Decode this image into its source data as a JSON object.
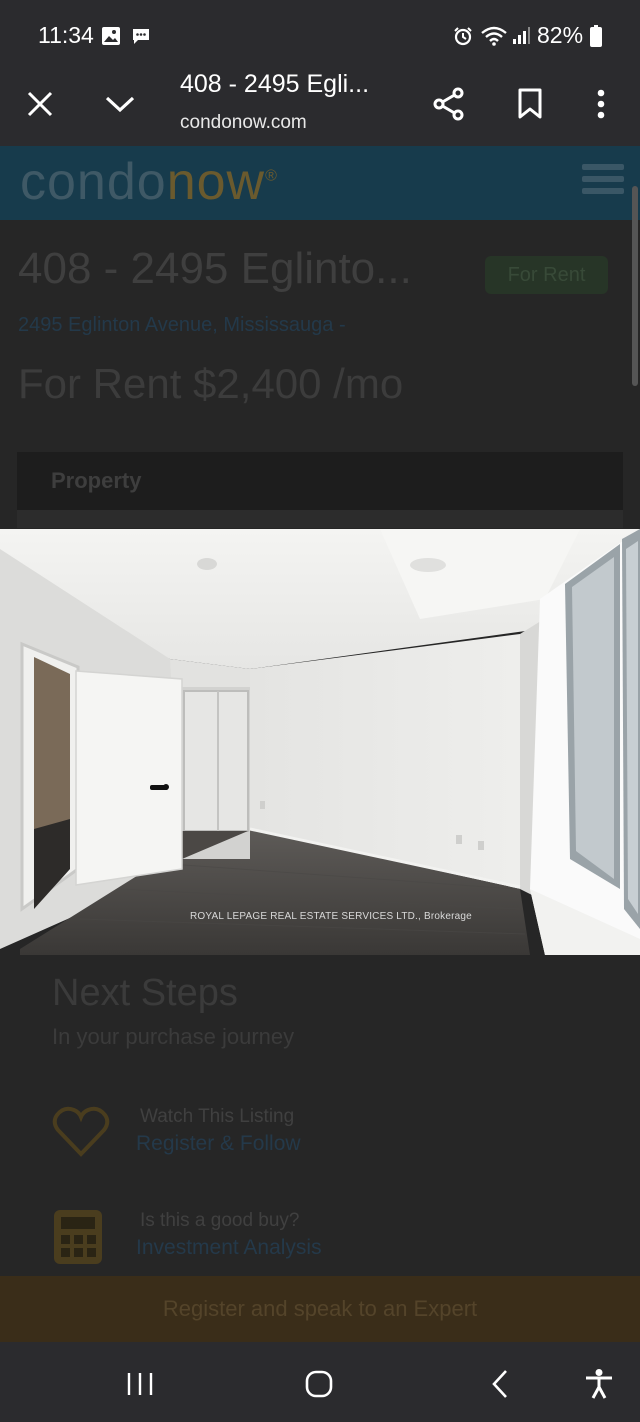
{
  "status_bar": {
    "time": "11:34",
    "battery": "82%",
    "icons": [
      "gallery-icon",
      "message-icon",
      "alarm-icon",
      "wifi-icon",
      "signal-icon",
      "battery-icon"
    ]
  },
  "browser": {
    "title": "408 - 2495 Egli...",
    "url": "condonow.com",
    "buttons": [
      "close-icon",
      "chevron-down-icon",
      "share-icon",
      "bookmark-icon",
      "more-vert-icon"
    ]
  },
  "site": {
    "logo_part1": "condo",
    "logo_part2": "now",
    "logo_mark": "®",
    "listing_title": "408 - 2495 Eglinto...",
    "status_badge": "For Rent",
    "address": "2495 Eglinton Avenue, Mississauga -",
    "price": "For Rent $2,400 /mo",
    "tab_label": "Property",
    "next_steps": {
      "title": "Next Steps",
      "subtitle": "In your purchase journey",
      "items": [
        {
          "label": "Watch This Listing",
          "link": "Register & Follow",
          "icon": "heart-icon"
        },
        {
          "label": "Is this a good buy?",
          "link": "Investment Analysis",
          "icon": "calculator-icon"
        }
      ]
    },
    "cta": "Register and speak to an Expert",
    "colors": {
      "header": "#173b4c",
      "brand_accent": "#f5a623",
      "dim_overlay": "#262626"
    }
  },
  "photo": {
    "watermark": "ROYAL LEPAGE REAL ESTATE SERVICES LTD., Brokerage"
  },
  "nav_bar": {
    "buttons": [
      "recents-icon",
      "home-icon",
      "back-icon",
      "accessibility-icon"
    ]
  }
}
